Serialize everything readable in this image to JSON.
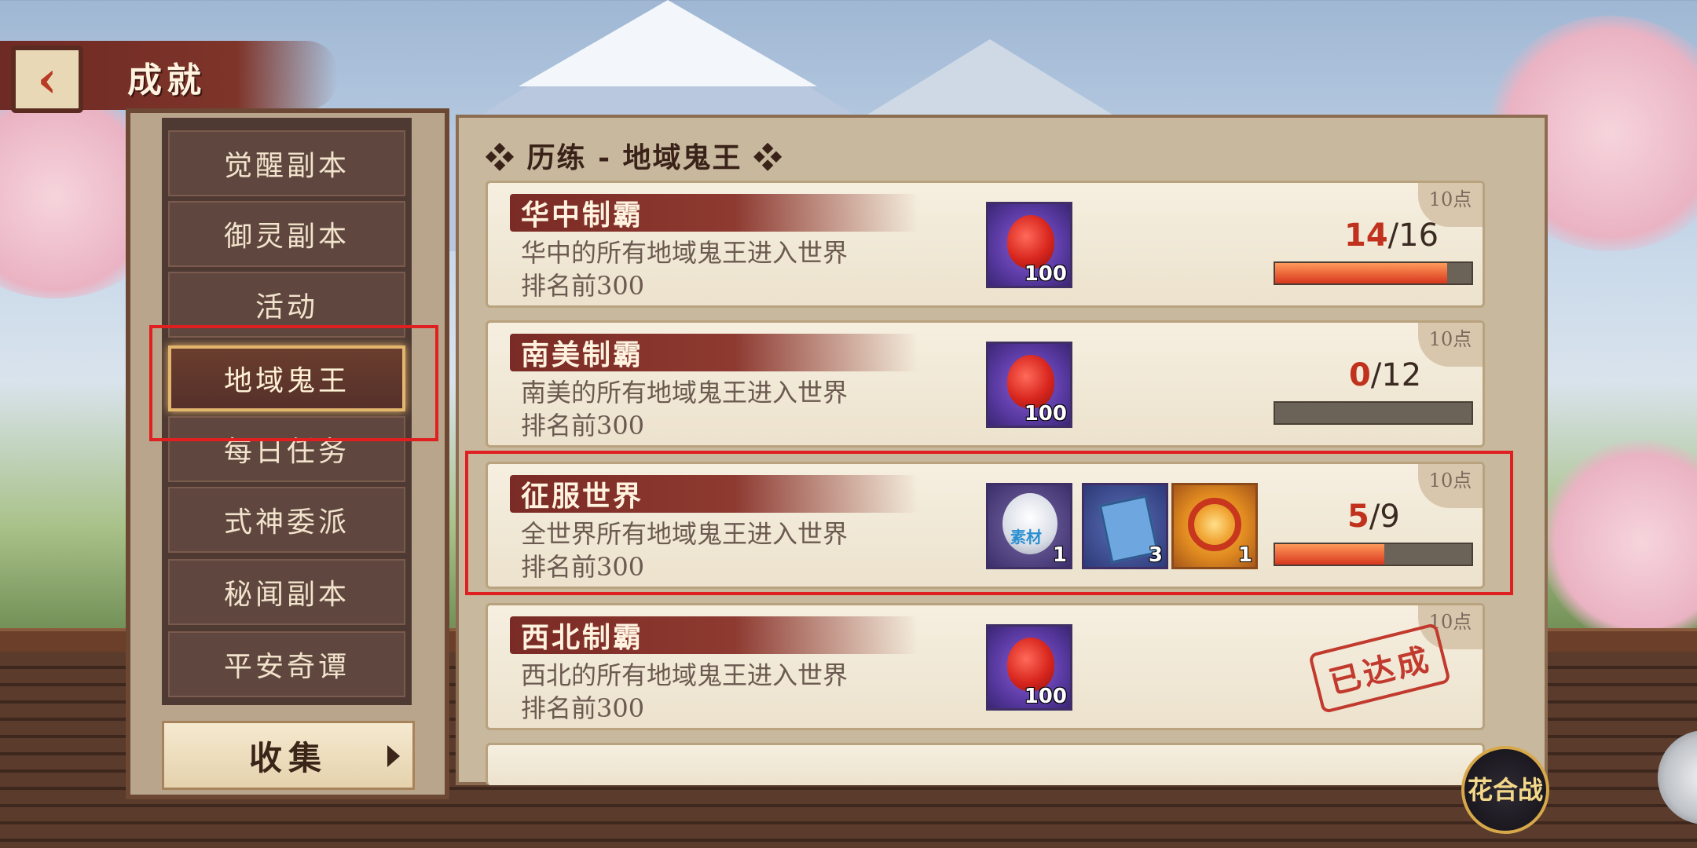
{
  "header": {
    "title": "成就",
    "back_icon": "back-arrow-icon"
  },
  "menu": {
    "items": [
      {
        "label": "觉醒副本",
        "active": false
      },
      {
        "label": "御灵副本",
        "active": false
      },
      {
        "label": "活动",
        "active": false
      },
      {
        "label": "地域鬼王",
        "active": true
      },
      {
        "label": "每日任务",
        "active": false
      },
      {
        "label": "式神委派",
        "active": false
      },
      {
        "label": "秘闻副本",
        "active": false
      },
      {
        "label": "平安奇谭",
        "active": false
      }
    ],
    "collect_label": "收集"
  },
  "section": {
    "title": "❖ 历练 - 地域鬼王 ❖"
  },
  "achievements": [
    {
      "title": "华中制霸",
      "desc_line1": "华中的所有地域鬼王进入世界",
      "desc_line2": "排名前300",
      "points": "10点",
      "rewards": [
        {
          "icon": "red-orb-icon",
          "count": "100"
        }
      ],
      "progress_current": "14",
      "progress_total": "/16",
      "progress": 0.875,
      "completed": false
    },
    {
      "title": "南美制霸",
      "desc_line1": "南美的所有地域鬼王进入世界",
      "desc_line2": "排名前300",
      "points": "10点",
      "rewards": [
        {
          "icon": "red-orb-icon",
          "count": "100"
        }
      ],
      "progress_current": "0",
      "progress_total": "/12",
      "progress": 0.0,
      "completed": false
    },
    {
      "title": "征服世界",
      "desc_line1": "全世界所有地域鬼王进入世界",
      "desc_line2": "排名前300",
      "points": "10点",
      "rewards": [
        {
          "icon": "daruma-material-icon",
          "label": "素材",
          "count": "1"
        },
        {
          "icon": "blue-ticket-icon",
          "count": "3"
        },
        {
          "icon": "golden-ring-icon",
          "count": "1"
        }
      ],
      "progress_current": "5",
      "progress_total": "/9",
      "progress": 0.5556,
      "completed": false
    },
    {
      "title": "西北制霸",
      "desc_line1": "西北的所有地域鬼王进入世界",
      "desc_line2": "排名前300",
      "points": "10点",
      "rewards": [
        {
          "icon": "red-orb-icon",
          "count": "100"
        }
      ],
      "completed": true,
      "completed_label": "已达成"
    }
  ],
  "corner_button": {
    "label": "花合战"
  }
}
